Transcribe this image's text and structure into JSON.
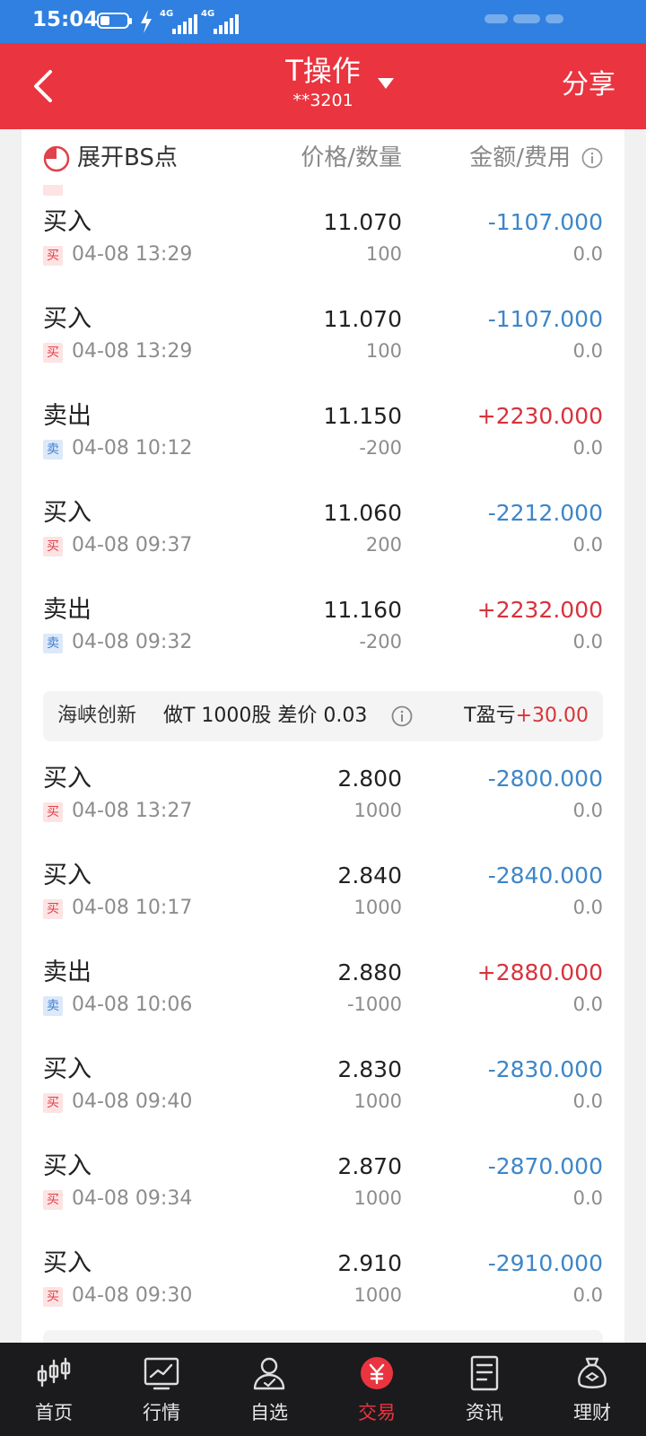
{
  "status_bar": {
    "time": "15:04",
    "signal_labels": [
      "4G",
      "4G"
    ]
  },
  "header": {
    "title": "T操作",
    "account": "**3201",
    "share_label": "分享"
  },
  "columns": {
    "expand_label": "展开BS点",
    "price_qty": "价格/数量",
    "amount_fee": "金额/费用"
  },
  "groups": [
    {
      "trades": [
        {
          "action": "买入",
          "badge": "买",
          "side": "buy",
          "datetime": "04-08 13:29",
          "price": "11.070",
          "qty": "100",
          "amount": "-1107.000",
          "fee": "0.0"
        },
        {
          "action": "买入",
          "badge": "买",
          "side": "buy",
          "datetime": "04-08 13:29",
          "price": "11.070",
          "qty": "100",
          "amount": "-1107.000",
          "fee": "0.0"
        },
        {
          "action": "卖出",
          "badge": "卖",
          "side": "sell",
          "datetime": "04-08 10:12",
          "price": "11.150",
          "qty": "-200",
          "amount": "+2230.000",
          "fee": "0.0"
        },
        {
          "action": "买入",
          "badge": "买",
          "side": "buy",
          "datetime": "04-08 09:37",
          "price": "11.060",
          "qty": "200",
          "amount": "-2212.000",
          "fee": "0.0"
        },
        {
          "action": "卖出",
          "badge": "卖",
          "side": "sell",
          "datetime": "04-08 09:32",
          "price": "11.160",
          "qty": "-200",
          "amount": "+2232.000",
          "fee": "0.0"
        }
      ]
    },
    {
      "summary": {
        "stock": "海峡创新",
        "desc": "做T 1000股 差价 0.03",
        "pl_label": "T盈亏",
        "pl_value": "+30.00"
      },
      "trades": [
        {
          "action": "买入",
          "badge": "买",
          "side": "buy",
          "datetime": "04-08 13:27",
          "price": "2.800",
          "qty": "1000",
          "amount": "-2800.000",
          "fee": "0.0"
        },
        {
          "action": "买入",
          "badge": "买",
          "side": "buy",
          "datetime": "04-08 10:17",
          "price": "2.840",
          "qty": "1000",
          "amount": "-2840.000",
          "fee": "0.0"
        },
        {
          "action": "卖出",
          "badge": "卖",
          "side": "sell",
          "datetime": "04-08 10:06",
          "price": "2.880",
          "qty": "-1000",
          "amount": "+2880.000",
          "fee": "0.0"
        },
        {
          "action": "买入",
          "badge": "买",
          "side": "buy",
          "datetime": "04-08 09:40",
          "price": "2.830",
          "qty": "1000",
          "amount": "-2830.000",
          "fee": "0.0"
        },
        {
          "action": "买入",
          "badge": "买",
          "side": "buy",
          "datetime": "04-08 09:34",
          "price": "2.870",
          "qty": "1000",
          "amount": "-2870.000",
          "fee": "0.0"
        },
        {
          "action": "买入",
          "badge": "买",
          "side": "buy",
          "datetime": "04-08 09:30",
          "price": "2.910",
          "qty": "1000",
          "amount": "-2910.000",
          "fee": "0.0"
        }
      ]
    }
  ],
  "nav": [
    {
      "label": "首页",
      "icon": "home-candlestick-icon",
      "active": false
    },
    {
      "label": "行情",
      "icon": "market-chart-icon",
      "active": false
    },
    {
      "label": "自选",
      "icon": "watchlist-person-icon",
      "active": false
    },
    {
      "label": "交易",
      "icon": "trade-yuan-icon",
      "active": true
    },
    {
      "label": "资讯",
      "icon": "news-document-icon",
      "active": false
    },
    {
      "label": "理财",
      "icon": "wealth-moneybag-icon",
      "active": false
    }
  ],
  "colors": {
    "brand_red": "#ea343f",
    "status_blue": "#2f80e0",
    "negative_blue": "#3d86c8",
    "positive_red": "#d8333b"
  }
}
